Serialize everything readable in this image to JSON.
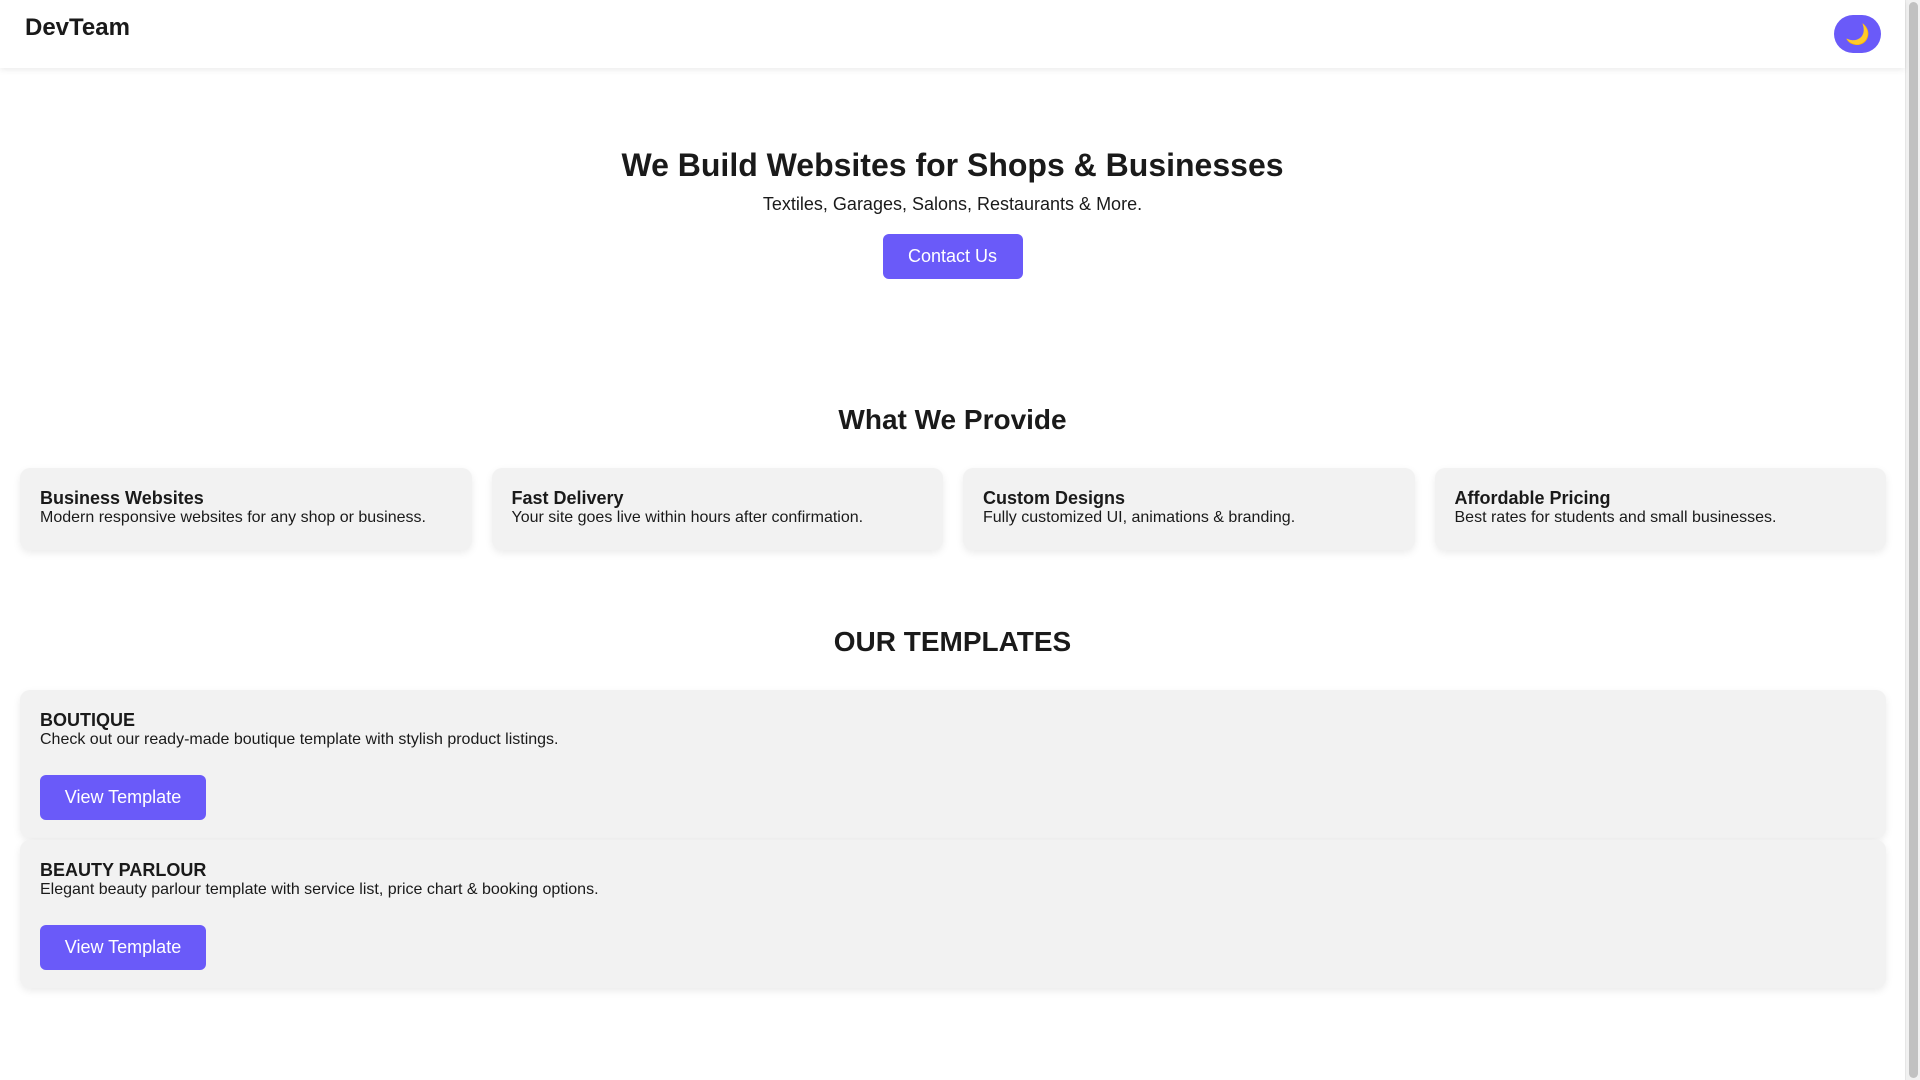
{
  "header": {
    "brand": "DevTeam",
    "theme_toggle_icon": "🌙",
    "theme_toggle_icon_name": "moon-icon"
  },
  "hero": {
    "title": "We Build Websites for Shops & Businesses",
    "subtitle": "Textiles, Garages, Salons, Restaurants & More.",
    "cta_label": "Contact Us"
  },
  "features": {
    "title": "What We Provide",
    "items": [
      {
        "title": "Business Websites",
        "description": "Modern responsive websites for any shop or business."
      },
      {
        "title": "Fast Delivery",
        "description": "Your site goes live within hours after confirmation."
      },
      {
        "title": "Custom Designs",
        "description": "Fully customized UI, animations & branding."
      },
      {
        "title": "Affordable Pricing",
        "description": "Best rates for students and small businesses."
      }
    ]
  },
  "templates": {
    "title": "OUR TEMPLATES",
    "items": [
      {
        "title": "BOUTIQUE",
        "description": "Check out our ready-made boutique template with stylish product listings.",
        "button_label": "View Template"
      },
      {
        "title": "BEAUTY PARLOUR",
        "description": "Elegant beauty parlour template with service list, price chart & booking options.",
        "button_label": "View Template"
      }
    ]
  },
  "colors": {
    "accent": "#6a5af9",
    "card_background": "#f2f2f2",
    "text": "#1a1a1a"
  }
}
